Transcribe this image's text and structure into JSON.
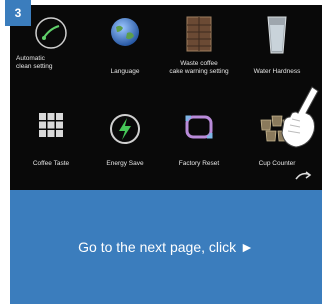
{
  "step_number": "3",
  "menu": {
    "row1": [
      {
        "label_line1": "Automatic",
        "label_line2": "clean setting",
        "icon": "clean-icon"
      },
      {
        "label_line1": "Language",
        "label_line2": "",
        "icon": "globe-icon"
      },
      {
        "label_line1": "Waste coffee",
        "label_line2": "cake warning setting",
        "icon": "waste-bin-icon"
      },
      {
        "label_line1": "Water Hardness",
        "label_line2": "",
        "icon": "water-glass-icon"
      }
    ],
    "row2": [
      {
        "label": "Coffee Taste",
        "icon": "grid-icon"
      },
      {
        "label": "Energy Save",
        "icon": "lightning-icon"
      },
      {
        "label": "Factory Reset",
        "icon": "reset-icon"
      },
      {
        "label": "Cup Counter",
        "icon": "cup-counter-icon"
      }
    ]
  },
  "banner": {
    "text": "Go to the next page, click ►"
  },
  "colors": {
    "accent": "#3b7dbd",
    "screen_bg": "#090909"
  }
}
